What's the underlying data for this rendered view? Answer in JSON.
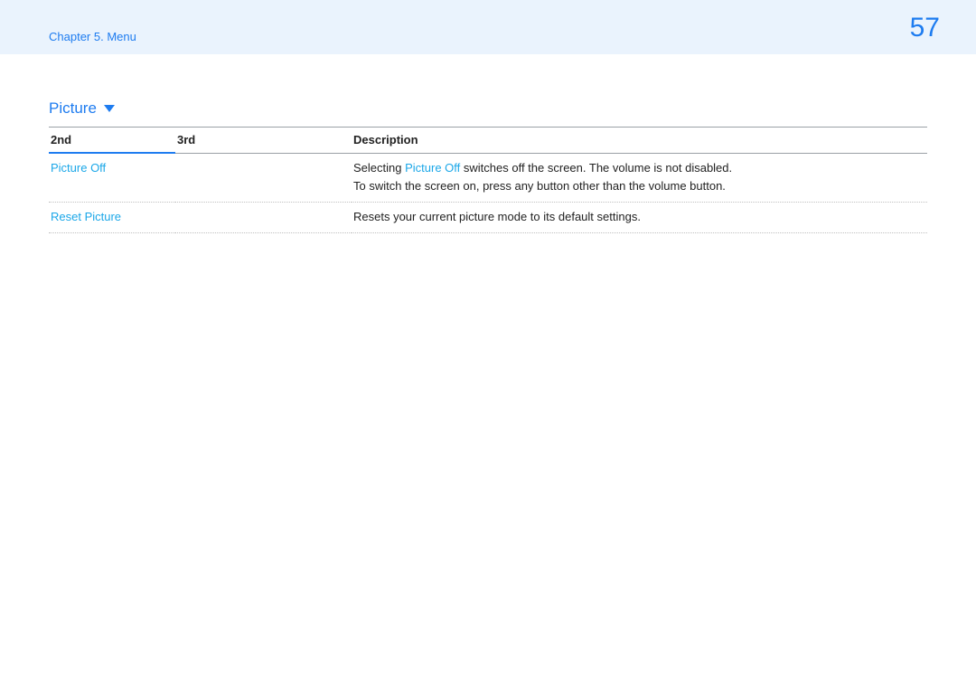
{
  "header": {
    "chapter": "Chapter 5. Menu",
    "page_number": "57"
  },
  "section": {
    "title": "Picture"
  },
  "table": {
    "headers": {
      "col1": "2nd",
      "col2": "3rd",
      "col3": "Description"
    },
    "rows": [
      {
        "second": "Picture Off",
        "third": "",
        "desc_prefix": "Selecting ",
        "desc_highlight": "Picture Off",
        "desc_suffix": " switches off the screen. The volume is not disabled.",
        "desc_line2": "To switch the screen on, press any button other than the volume button."
      },
      {
        "second": "Reset Picture",
        "third": "",
        "desc": "Resets your current picture mode to its default settings."
      }
    ]
  }
}
